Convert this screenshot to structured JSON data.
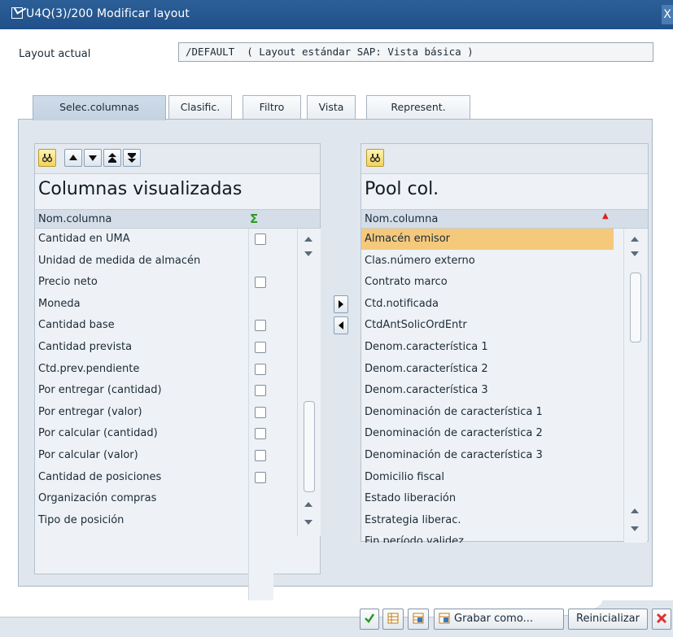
{
  "window": {
    "title": "U4Q(3)/200 Modificar layout",
    "close_glyph": "X"
  },
  "layout": {
    "label": "Layout actual",
    "value": "/DEFAULT  ( Layout estándar SAP: Vista básica )"
  },
  "tabs": [
    {
      "label": "Selec.columnas",
      "active": true
    },
    {
      "label": "Clasific.",
      "active": false
    },
    {
      "label": "Filtro",
      "active": false
    },
    {
      "label": "Vista",
      "active": false
    },
    {
      "label": "Represent.",
      "active": false
    }
  ],
  "left_table": {
    "title": "Columnas visualizadas",
    "header": "Nom.columna",
    "sum_icon": "Σ",
    "rows": [
      {
        "label": "Cantidad en UMA",
        "checkbox": true
      },
      {
        "label": "Unidad de medida de almacén",
        "checkbox": false
      },
      {
        "label": "Precio neto",
        "checkbox": true
      },
      {
        "label": "Moneda",
        "checkbox": false
      },
      {
        "label": "Cantidad base",
        "checkbox": true
      },
      {
        "label": "Cantidad prevista",
        "checkbox": true
      },
      {
        "label": "Ctd.prev.pendiente",
        "checkbox": true
      },
      {
        "label": "Por entregar (cantidad)",
        "checkbox": true
      },
      {
        "label": "Por entregar (valor)",
        "checkbox": true
      },
      {
        "label": "Por calcular (cantidad)",
        "checkbox": true
      },
      {
        "label": "Por calcular (valor)",
        "checkbox": true
      },
      {
        "label": "Cantidad de posiciones",
        "checkbox": true
      },
      {
        "label": "Organización compras",
        "checkbox": false
      },
      {
        "label": "Tipo de posición",
        "checkbox": false
      }
    ]
  },
  "right_table": {
    "title": "Pool col.",
    "header": "Nom.columna",
    "rows": [
      "Almacén emisor",
      "Clas.número externo",
      "Contrato marco",
      "Ctd.notificada",
      "CtdAntSolicOrdEntr",
      "Denom.característica 1",
      "Denom.característica 2",
      "Denom.característica 3",
      "Denominación de característica 1",
      "Denominación de característica 2",
      "Denominación de característica 3",
      "Domicilio fiscal",
      "Estado liberación",
      "Estrategia liberac.",
      "Fin período validez"
    ],
    "selected_index": 0
  },
  "footer": {
    "save_as": "Grabar como...",
    "reset": "Reinicializar"
  },
  "colors": {
    "title_bar": "#20508a",
    "selected_row": "#f5c97c",
    "panel": "#dfe6ed"
  }
}
